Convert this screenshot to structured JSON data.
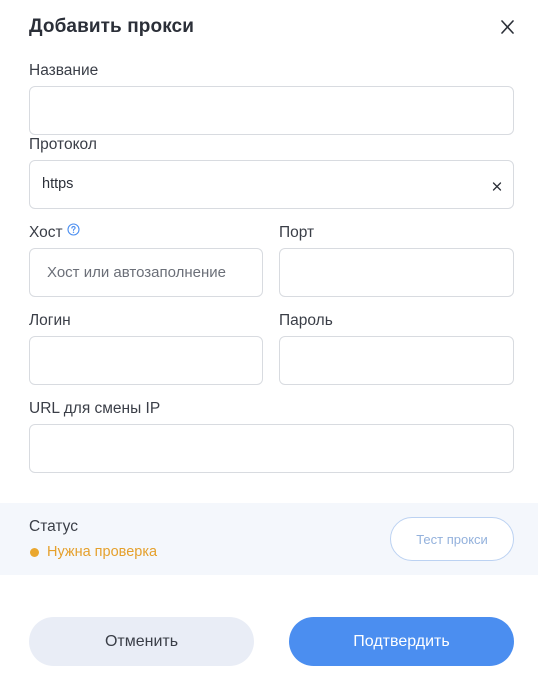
{
  "dialog": {
    "title": "Добавить прокси",
    "close_icon": "close-icon"
  },
  "form": {
    "name": {
      "label": "Название",
      "value": "",
      "placeholder": ""
    },
    "protocol": {
      "label": "Протокол",
      "value": "https",
      "clear_icon": "clear-icon"
    },
    "host": {
      "label": "Хост",
      "value": "",
      "placeholder": "Хост или автозаполнение",
      "help_icon": "question-circle-icon"
    },
    "port": {
      "label": "Порт",
      "value": "",
      "placeholder": ""
    },
    "login": {
      "label": "Логин",
      "value": "",
      "placeholder": ""
    },
    "password": {
      "label": "Пароль",
      "value": "",
      "placeholder": ""
    },
    "ip_change_url": {
      "label": "URL для смены IP",
      "value": "",
      "placeholder": ""
    }
  },
  "status": {
    "label": "Статус",
    "value": "Нужна проверка",
    "color": "#eaa72f",
    "test_button": "Тест прокси"
  },
  "actions": {
    "cancel": "Отменить",
    "confirm": "Подтвердить",
    "confirm_color": "#4b8ef0"
  }
}
